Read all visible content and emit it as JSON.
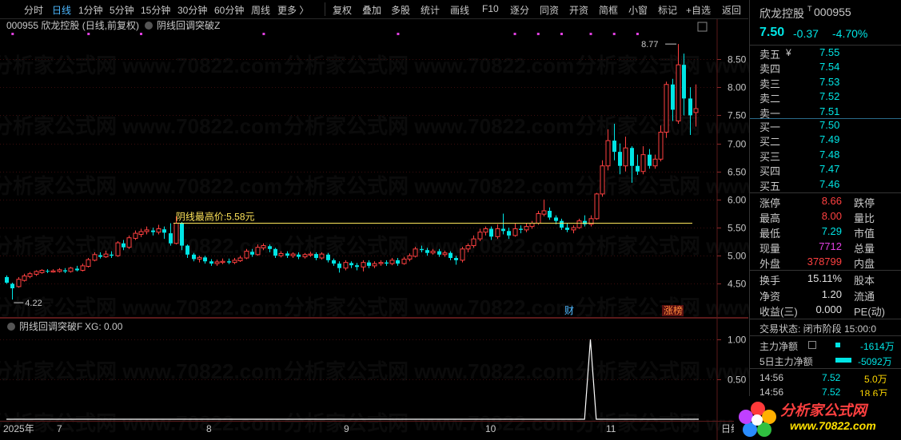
{
  "toolbar": {
    "periods": [
      "分时",
      "日线",
      "1分钟",
      "5分钟",
      "15分钟",
      "30分钟",
      "60分钟",
      "周线",
      "更多 〉"
    ],
    "active_period": "日线",
    "tools": [
      "复权",
      "叠加",
      "多股",
      "统计",
      "画线",
      "F10",
      "逐分",
      "同资",
      "开资",
      "简框",
      "小窗",
      "标记",
      "+自选",
      "返回"
    ]
  },
  "main_header": {
    "title": "000955 欣龙控股 (日线,前复权)",
    "indicator": "阴线回调突破Z"
  },
  "annotations": {
    "high_line_label": "阴线最高价:5.58元",
    "max_price_label": "8.77",
    "min_price_label": "4.22",
    "badge_cai": "财",
    "badge_zhangbang": "涨榜"
  },
  "sub_header": {
    "indicator": "阴线回调突破F",
    "xg_label": "XG: 0.00"
  },
  "x_axis": {
    "labels": [
      "2025年",
      "7",
      "8",
      "9",
      "10",
      "11"
    ],
    "corner": "日线"
  },
  "watermark": "分析家公式网 www.70822.com",
  "logo": {
    "text": "分析家公式网",
    "url": "www.70822.com"
  },
  "colors": {
    "up": "#ff4040",
    "down": "#00e5e5",
    "line": "#ffe55a",
    "grid": "#3a0d0d",
    "magenta": "#e040e0"
  },
  "chart_data": [
    {
      "type": "candlestick",
      "title": "000955 欣龙控股 (日线,前复权)",
      "y_ticks": [
        4.5,
        5.0,
        5.5,
        6.0,
        6.5,
        7.0,
        7.5,
        8.0,
        8.5
      ],
      "ylim": [
        4.15,
        8.9
      ],
      "reference_line": 5.58,
      "candles": [
        [
          4.62,
          4.52,
          4.65,
          4.5
        ],
        [
          4.5,
          4.42,
          4.52,
          4.22
        ],
        [
          4.45,
          4.58,
          4.62,
          4.43
        ],
        [
          4.56,
          4.64,
          4.68,
          4.54
        ],
        [
          4.63,
          4.68,
          4.71,
          4.6
        ],
        [
          4.67,
          4.72,
          4.74,
          4.64
        ],
        [
          4.7,
          4.74,
          4.76,
          4.68
        ],
        [
          4.73,
          4.72,
          4.76,
          4.69
        ],
        [
          4.71,
          4.73,
          4.76,
          4.7
        ],
        [
          4.72,
          4.75,
          4.78,
          4.7
        ],
        [
          4.74,
          4.72,
          4.78,
          4.69
        ],
        [
          4.72,
          4.78,
          4.8,
          4.7
        ],
        [
          4.77,
          4.74,
          4.82,
          4.72
        ],
        [
          4.74,
          4.82,
          4.86,
          4.72
        ],
        [
          4.81,
          4.93,
          4.96,
          4.79
        ],
        [
          4.92,
          5.02,
          5.06,
          4.9
        ],
        [
          5.01,
          4.98,
          5.06,
          4.95
        ],
        [
          4.98,
          5.03,
          5.09,
          4.96
        ],
        [
          5.02,
          5.0,
          5.08,
          4.96
        ],
        [
          5.0,
          5.23,
          5.26,
          4.98
        ],
        [
          5.22,
          5.15,
          5.28,
          5.1
        ],
        [
          5.15,
          5.32,
          5.36,
          5.12
        ],
        [
          5.31,
          5.4,
          5.45,
          5.28
        ],
        [
          5.38,
          5.43,
          5.48,
          5.33
        ],
        [
          5.43,
          5.46,
          5.52,
          5.38
        ],
        [
          5.45,
          5.42,
          5.5,
          5.36
        ],
        [
          5.42,
          5.48,
          5.55,
          5.38
        ],
        [
          5.47,
          5.41,
          5.52,
          5.3
        ],
        [
          5.4,
          5.22,
          5.58,
          5.18
        ],
        [
          5.22,
          5.58,
          5.7,
          5.2
        ],
        [
          5.58,
          5.18,
          5.6,
          5.1
        ],
        [
          5.18,
          5.02,
          5.2,
          4.96
        ],
        [
          5.02,
          4.94,
          5.05,
          4.9
        ],
        [
          4.94,
          4.97,
          5.0,
          4.88
        ],
        [
          4.97,
          4.9,
          5.0,
          4.86
        ],
        [
          4.9,
          4.86,
          4.94,
          4.82
        ],
        [
          4.86,
          4.89,
          4.93,
          4.82
        ],
        [
          4.88,
          4.9,
          4.95,
          4.85
        ],
        [
          4.9,
          4.88,
          4.95,
          4.85
        ],
        [
          4.88,
          4.92,
          4.96,
          4.85
        ],
        [
          4.91,
          4.96,
          5.0,
          4.89
        ],
        [
          4.96,
          5.08,
          5.12,
          4.94
        ],
        [
          5.07,
          5.02,
          5.12,
          4.98
        ],
        [
          5.02,
          5.15,
          5.2,
          5.0
        ],
        [
          5.14,
          5.18,
          5.22,
          5.1
        ],
        [
          5.17,
          5.12,
          5.2,
          5.06
        ],
        [
          5.12,
          5.0,
          5.14,
          4.96
        ],
        [
          5.0,
          5.04,
          5.08,
          4.97
        ],
        [
          5.04,
          5.0,
          5.08,
          4.96
        ],
        [
          5.0,
          5.03,
          5.06,
          4.96
        ],
        [
          5.02,
          4.98,
          5.06,
          4.94
        ],
        [
          4.98,
          5.02,
          5.05,
          4.95
        ],
        [
          5.01,
          5.03,
          5.07,
          4.98
        ],
        [
          5.03,
          4.96,
          5.06,
          4.92
        ],
        [
          4.96,
          5.03,
          5.06,
          4.93
        ],
        [
          5.02,
          4.92,
          5.05,
          4.88
        ],
        [
          4.92,
          4.86,
          4.95,
          4.82
        ],
        [
          4.86,
          4.78,
          4.9,
          4.7
        ],
        [
          4.78,
          4.88,
          4.92,
          4.74
        ],
        [
          4.87,
          4.83,
          4.9,
          4.78
        ],
        [
          4.83,
          4.8,
          4.87,
          4.74
        ],
        [
          4.8,
          4.88,
          4.92,
          4.72
        ],
        [
          4.88,
          4.82,
          4.92,
          4.78
        ],
        [
          4.82,
          4.86,
          4.9,
          4.78
        ],
        [
          4.86,
          4.88,
          4.92,
          4.82
        ],
        [
          4.88,
          4.86,
          4.92,
          4.82
        ],
        [
          4.86,
          4.92,
          4.96,
          4.83
        ],
        [
          4.92,
          4.86,
          4.96,
          4.82
        ],
        [
          4.86,
          4.94,
          4.98,
          4.84
        ],
        [
          4.94,
          5.0,
          5.04,
          4.9
        ],
        [
          4.99,
          5.12,
          5.16,
          4.97
        ],
        [
          5.12,
          5.1,
          5.18,
          5.06
        ],
        [
          5.1,
          5.05,
          5.14,
          5.0
        ],
        [
          5.05,
          5.08,
          5.12,
          5.02
        ],
        [
          5.08,
          5.02,
          5.12,
          4.98
        ],
        [
          5.02,
          5.05,
          5.09,
          4.98
        ],
        [
          5.05,
          4.96,
          5.08,
          4.92
        ],
        [
          4.96,
          4.92,
          5.0,
          4.84
        ],
        [
          4.92,
          5.12,
          5.16,
          4.88
        ],
        [
          5.12,
          5.18,
          5.22,
          5.06
        ],
        [
          5.18,
          5.3,
          5.36,
          5.14
        ],
        [
          5.3,
          5.42,
          5.48,
          5.26
        ],
        [
          5.42,
          5.48,
          5.52,
          5.36
        ],
        [
          5.48,
          5.34,
          5.52,
          5.28
        ],
        [
          5.34,
          5.48,
          5.56,
          5.3
        ],
        [
          5.48,
          5.44,
          5.75,
          5.38
        ],
        [
          5.44,
          5.36,
          5.5,
          5.3
        ],
        [
          5.36,
          5.48,
          5.58,
          5.34
        ],
        [
          5.48,
          5.46,
          5.54,
          5.4
        ],
        [
          5.46,
          5.52,
          5.58,
          5.42
        ],
        [
          5.52,
          5.58,
          5.62,
          5.48
        ],
        [
          5.58,
          5.75,
          5.8,
          5.55
        ],
        [
          5.74,
          5.8,
          6.0,
          5.7
        ],
        [
          5.8,
          5.68,
          5.86,
          5.64
        ],
        [
          5.68,
          5.62,
          5.72,
          5.56
        ],
        [
          5.62,
          5.5,
          5.66,
          5.46
        ],
        [
          5.5,
          5.46,
          5.58,
          5.42
        ],
        [
          5.46,
          5.5,
          5.54,
          5.4
        ],
        [
          5.5,
          5.62,
          5.66,
          5.48
        ],
        [
          5.62,
          5.56,
          5.72,
          5.52
        ],
        [
          5.56,
          5.66,
          5.72,
          5.52
        ],
        [
          5.66,
          6.1,
          6.12,
          5.64
        ],
        [
          6.1,
          6.6,
          6.7,
          6.05
        ],
        [
          6.6,
          7.05,
          7.25,
          6.52
        ],
        [
          7.05,
          6.85,
          7.35,
          6.7
        ],
        [
          6.85,
          6.6,
          7.0,
          6.45
        ],
        [
          6.6,
          6.92,
          7.12,
          6.5
        ],
        [
          6.92,
          6.6,
          6.95,
          6.3
        ],
        [
          6.6,
          6.5,
          6.8,
          6.44
        ],
        [
          6.5,
          6.8,
          6.95,
          6.45
        ],
        [
          6.8,
          6.6,
          6.9,
          6.55
        ],
        [
          6.6,
          6.72,
          6.8,
          6.55
        ],
        [
          6.72,
          7.2,
          7.32,
          6.68
        ],
        [
          7.2,
          8.05,
          8.1,
          7.1
        ],
        [
          8.05,
          7.6,
          8.15,
          7.4
        ],
        [
          7.4,
          8.4,
          8.77,
          7.35
        ],
        [
          8.4,
          7.8,
          8.6,
          7.5
        ],
        [
          7.8,
          7.5,
          8.0,
          7.15
        ],
        [
          7.55,
          7.62,
          8.05,
          7.3
        ]
      ]
    },
    {
      "type": "line",
      "title": "阴线回调突破F",
      "y_ticks": [
        0.5,
        1.0
      ],
      "ylim": [
        0,
        1.12
      ],
      "signal_index": 100,
      "values": "all 0 except 1.00 at signal_index"
    }
  ],
  "stock": {
    "name": "欣龙控股",
    "code": "000955",
    "price": "7.50",
    "change": "-0.37",
    "change_pct": "-4.70%"
  },
  "orderbook": {
    "sells": [
      {
        "label": "卖五",
        "price": "7.55",
        "vol": ""
      },
      {
        "label": "卖四",
        "price": "7.54",
        "vol": ""
      },
      {
        "label": "卖三",
        "price": "7.53",
        "vol": ""
      },
      {
        "label": "卖二",
        "price": "7.52",
        "vol": ""
      },
      {
        "label": "卖一",
        "price": "7.51",
        "vol": ""
      }
    ],
    "buys": [
      {
        "label": "买一",
        "price": "7.50",
        "vol": ""
      },
      {
        "label": "买二",
        "price": "7.49",
        "vol": ""
      },
      {
        "label": "买三",
        "price": "7.48",
        "vol": ""
      },
      {
        "label": "买四",
        "price": "7.47",
        "vol": ""
      },
      {
        "label": "买五",
        "price": "7.46",
        "vol": ""
      }
    ]
  },
  "quote": {
    "rows": [
      {
        "l1": "涨停",
        "v1": "8.66",
        "c1": "red",
        "l2": "跌停"
      },
      {
        "l1": "最高",
        "v1": "8.00",
        "c1": "red",
        "l2": "量比"
      },
      {
        "l1": "最低",
        "v1": "7.29",
        "c1": "green",
        "l2": "市值"
      },
      {
        "l1": "现量",
        "v1": "7712",
        "c1": "magenta",
        "l2": "总量"
      },
      {
        "l1": "外盘",
        "v1": "378799",
        "c1": "red",
        "l2": "内盘"
      }
    ],
    "rows2": [
      {
        "l1": "换手",
        "v1": "15.11%",
        "l2": "股本"
      },
      {
        "l1": "净资",
        "v1": "1.20",
        "l2": "流通"
      },
      {
        "l1": "收益(三)",
        "v1": "0.000",
        "l2": "PE(动)"
      }
    ],
    "trade_status": "交易状态: 闭市阶段 15:00:0",
    "main_net": {
      "label": "主力净额",
      "value": "-1614万"
    },
    "main_net5": {
      "label": "5日主力净额",
      "value": "-5092万"
    },
    "ticks": [
      {
        "time": "14:56",
        "price": "7.52",
        "vol": "5.0万"
      },
      {
        "time": "14:56",
        "price": "7.52",
        "vol": "18.6万"
      }
    ]
  }
}
